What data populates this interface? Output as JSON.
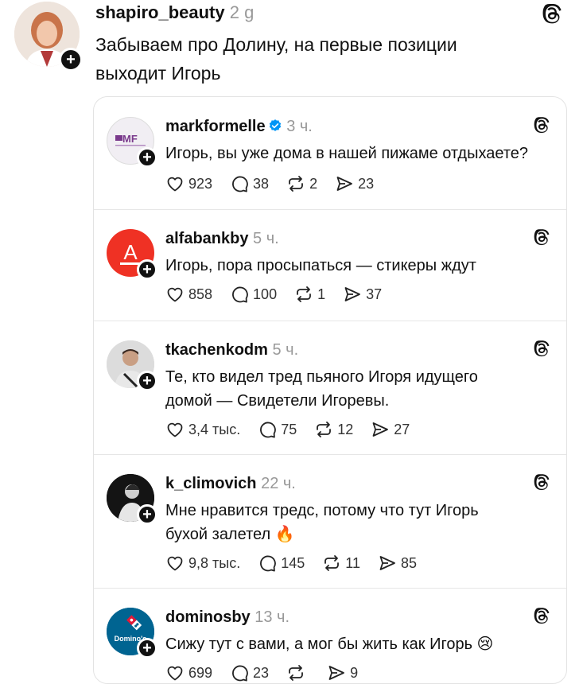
{
  "post": {
    "username": "shapiro_beauty",
    "time": "2 g",
    "text_line1": "Забываем про Долину, на первые позиции",
    "text_line2": "выходит Игорь"
  },
  "replies": [
    {
      "username": "markformelle",
      "verified": true,
      "time": "3 ч.",
      "text": "Игорь, вы уже дома в нашей пижаме отдыхаете?",
      "likes": "923",
      "comments": "38",
      "reposts": "2",
      "shares": "23",
      "avatar_text": "MF",
      "avatar_bg": "#f1eef3"
    },
    {
      "username": "alfabankby",
      "time": "5 ч.",
      "text": "Игорь, пора просыпаться — стикеры ждут",
      "likes": "858",
      "comments": "100",
      "reposts": "1",
      "shares": "37",
      "avatar_text": "A",
      "avatar_bg": "#ef3124"
    },
    {
      "username": "tkachenkodm",
      "time": "5 ч.",
      "text_line1": "Те, кто видел тред пьяного Игоря идущего",
      "text_line2": "домой — Свидетели Игоревы.",
      "likes": "3,4 тыс.",
      "comments": "75",
      "reposts": "12",
      "shares": "27"
    },
    {
      "username": "k_climovich",
      "time": "22 ч.",
      "text_line1": "Мне нравится тредс, потому что тут Игорь",
      "text_line2": "бухой залетел 🔥",
      "likes": "9,8 тыс.",
      "comments": "145",
      "reposts": "11",
      "shares": "85"
    },
    {
      "username": "dominosby",
      "time": "13 ч.",
      "text": "Сижу тут с вами, а мог бы жить как Игорь 😢",
      "likes": "699",
      "comments": "23",
      "reposts": "",
      "shares": "9",
      "avatar_text": "Domino's",
      "avatar_bg": "#006491"
    }
  ],
  "colors": {
    "accent": "#0095f6",
    "alfa_red": "#ef3124",
    "dominos_blue": "#006491",
    "dominos_red": "#e31837"
  }
}
